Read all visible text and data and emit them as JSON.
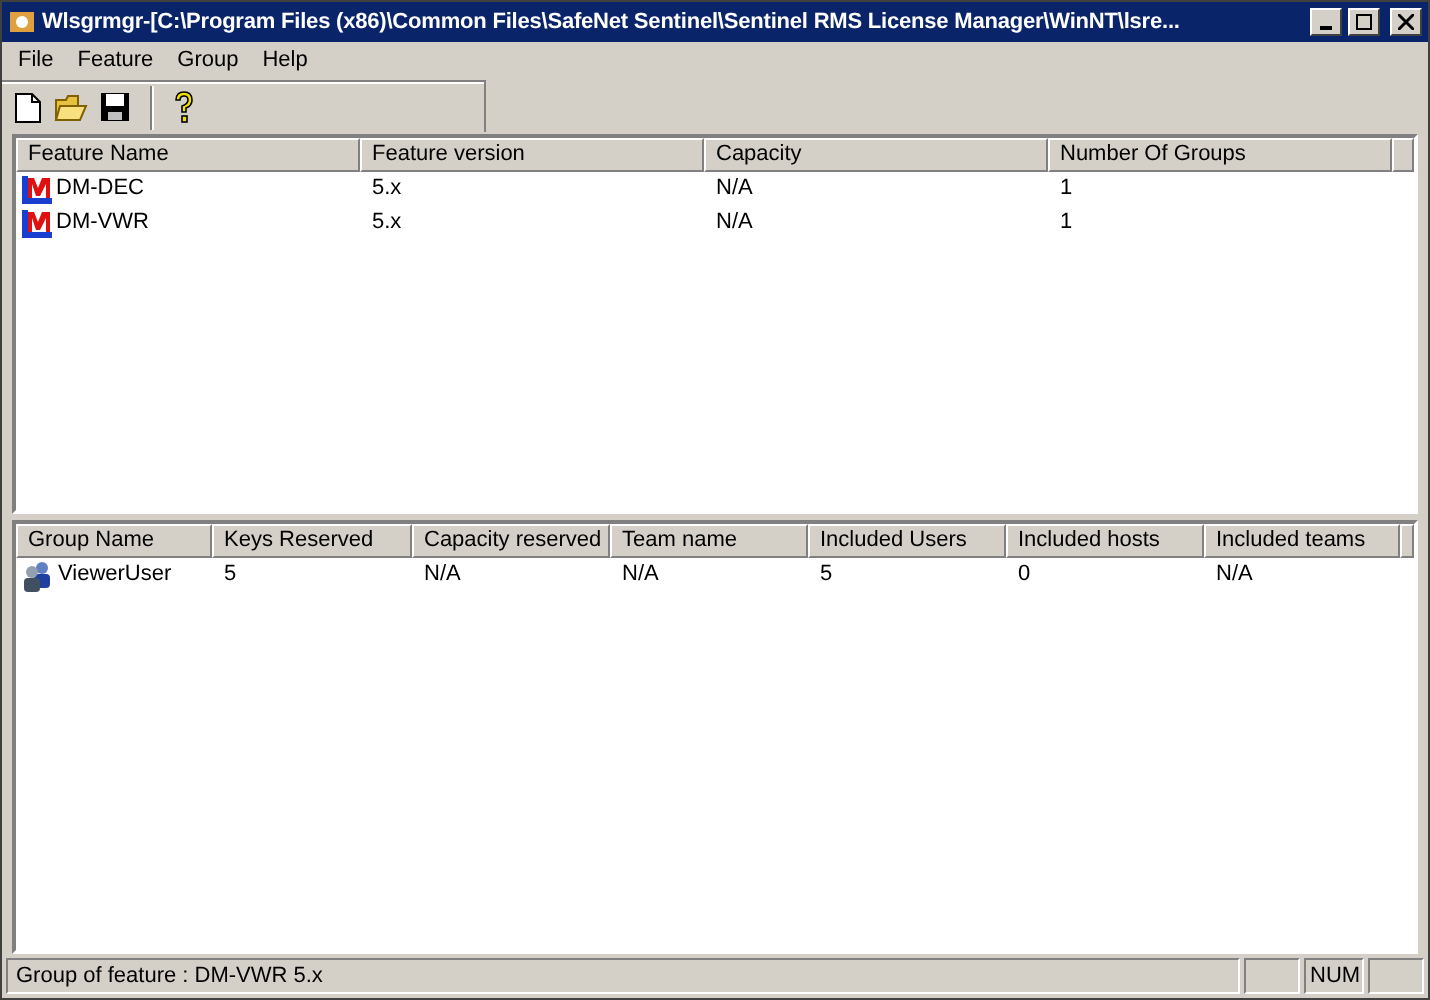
{
  "window": {
    "title": "Wlsgrmgr-[C:\\Program Files (x86)\\Common Files\\SafeNet Sentinel\\Sentinel RMS License Manager\\WinNT\\lsre..."
  },
  "menu": [
    "File",
    "Feature",
    "Group",
    "Help"
  ],
  "toolbar": [
    {
      "kind": "new"
    },
    {
      "kind": "open"
    },
    {
      "kind": "save"
    },
    {
      "kind": "sep"
    },
    {
      "kind": "help"
    }
  ],
  "features": {
    "columns": [
      "Feature Name",
      "Feature version",
      "Capacity",
      "Number Of Groups"
    ],
    "rows": [
      [
        "DM-DEC",
        "5.x",
        "N/A",
        "1"
      ],
      [
        "DM-VWR",
        "5.x",
        "N/A",
        "1"
      ]
    ]
  },
  "groups": {
    "columns": [
      "Group Name",
      "Keys Reserved",
      "Capacity reserved",
      "Team name",
      "Included Users",
      "Included hosts",
      "Included teams"
    ],
    "rows": [
      [
        "ViewerUser",
        "5",
        "N/A",
        "N/A",
        "5",
        "0",
        "N/A"
      ]
    ]
  },
  "status_bar": {
    "text": "Group of feature : DM-VWR 5.x",
    "num_indicator": "NUM"
  }
}
